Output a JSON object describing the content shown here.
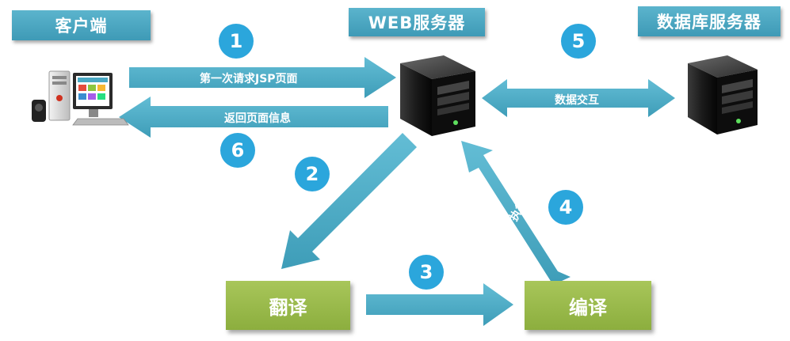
{
  "nodes": {
    "client": "客户端",
    "web_server": "WEB服务器",
    "db_server": "数据库服务器",
    "translate": "翻译",
    "compile": "编译"
  },
  "steps": {
    "s1": "1",
    "s2": "2",
    "s3": "3",
    "s4": "4",
    "s5": "5",
    "s6": "6"
  },
  "arrows": {
    "request": "第一次请求JSP页面",
    "response": "返回页面信息",
    "data_exchange": "数据交互",
    "execute": "执行"
  },
  "colors": {
    "header_box": "#4aa8c3",
    "green_box": "#9bbb4e",
    "arrow": "#4fb0c9",
    "step_circle": "#2ba6dc"
  }
}
